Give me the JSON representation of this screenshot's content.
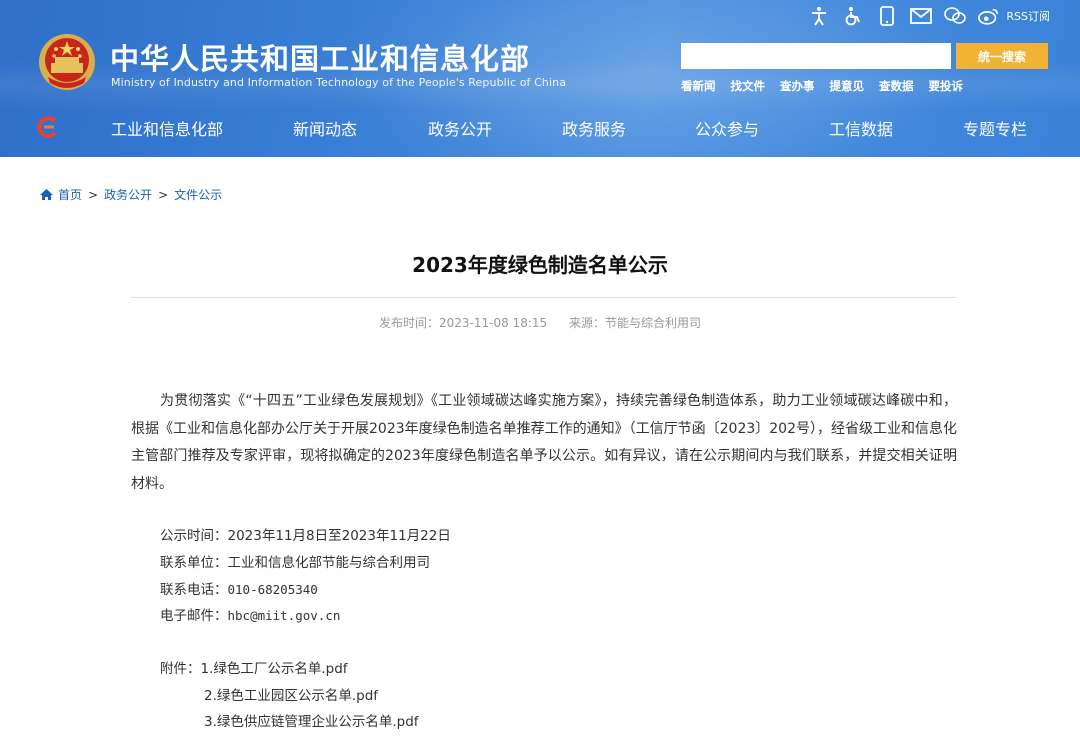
{
  "header": {
    "title": "中华人民共和国工业和信息化部",
    "subtitle": "Ministry of Industry and Information Technology of the People's Republic of China",
    "rss_label": "RSS订阅",
    "search": {
      "placeholder": "",
      "button_label": "统一搜索"
    },
    "quick_links": [
      "看新闻",
      "找文件",
      "查办事",
      "提意见",
      "查数据",
      "要投诉"
    ],
    "top_icons": [
      "accessibility-icon",
      "wheelchair-icon",
      "mobile-icon",
      "mail-icon",
      "wechat-icon",
      "weibo-icon"
    ],
    "accent_color": "#f2b233"
  },
  "nav": {
    "items": [
      "工业和信息化部",
      "新闻动态",
      "政务公开",
      "政务服务",
      "公众参与",
      "工信数据",
      "专题专栏"
    ]
  },
  "breadcrumb": [
    "首页",
    "政务公开",
    "文件公示"
  ],
  "article": {
    "title": "2023年度绿色制造名单公示",
    "publish_time": "发布时间：2023-11-08 18:15",
    "source": "来源：节能与综合利用司",
    "paragraph": "为贯彻落实《“十四五”工业绿色发展规划》《工业领域碳达峰实施方案》，持续完善绿色制造体系，助力工业领域碳达峰碳中和，根据《工业和信息化部办公厅关于开展2023年度绿色制造名单推荐工作的通知》（工信厅节函〔2023〕202号），经省级工业和信息化主管部门推荐及专家评审，现将拟确定的2023年度绿色制造名单予以公示。如有异议，请在公示期间内与我们联系，并提交相关证明材料。",
    "notice_period_label": "公示时间：",
    "notice_period": "2023年11月8日至2023年11月22日",
    "contact_unit_label": "联系单位：",
    "contact_unit": "工业和信息化部节能与综合利用司",
    "phone_label": "联系电话：",
    "phone": "010-68205340",
    "email_label": "电子邮件：",
    "email": "hbc@miit.gov.cn",
    "attachments_label": "附件：",
    "attachments": [
      "1.绿色工厂公示名单.pdf",
      "2.绿色工业园区公示名单.pdf",
      "3.绿色供应链管理企业公示名单.pdf"
    ]
  }
}
